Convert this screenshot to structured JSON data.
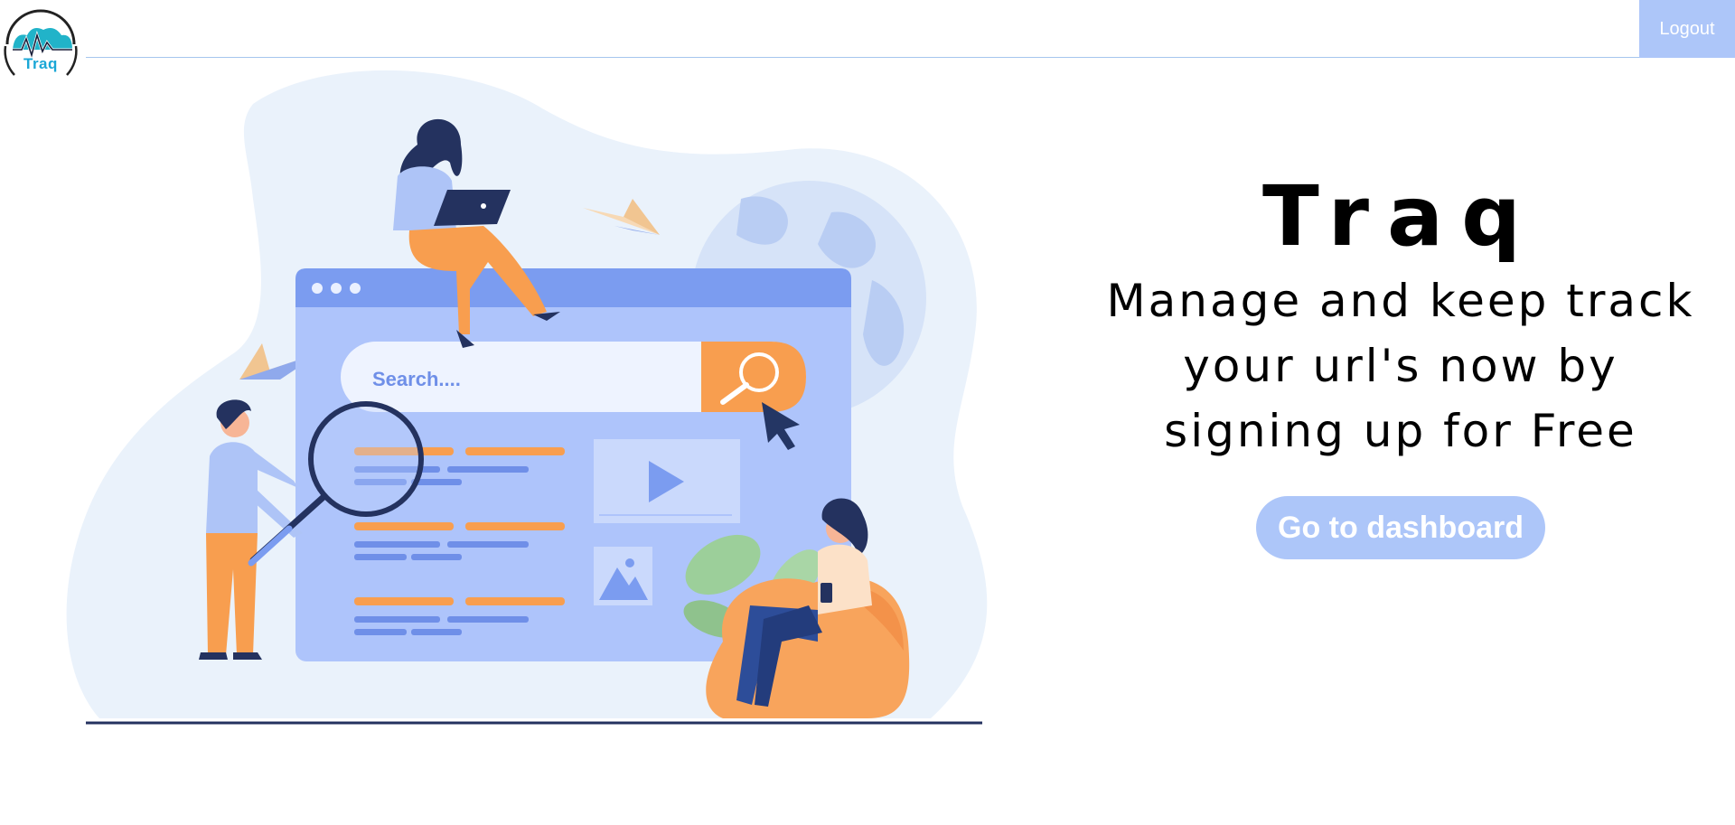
{
  "brand": {
    "logo_text": "Traq"
  },
  "header": {
    "logout_label": "Logout"
  },
  "hero": {
    "title": "Traq",
    "subtitle": "Manage and keep track your url's now by signing up for Free",
    "cta_label": "Go to dashboard"
  },
  "illustration": {
    "search_placeholder": "Search...."
  },
  "colors": {
    "accent": "#adc6f9",
    "browser_header": "#7b9cf0",
    "browser_body": "#aec4fb",
    "orange": "#f89e4f",
    "navy": "#243664",
    "blob": "#eaf2fb"
  }
}
